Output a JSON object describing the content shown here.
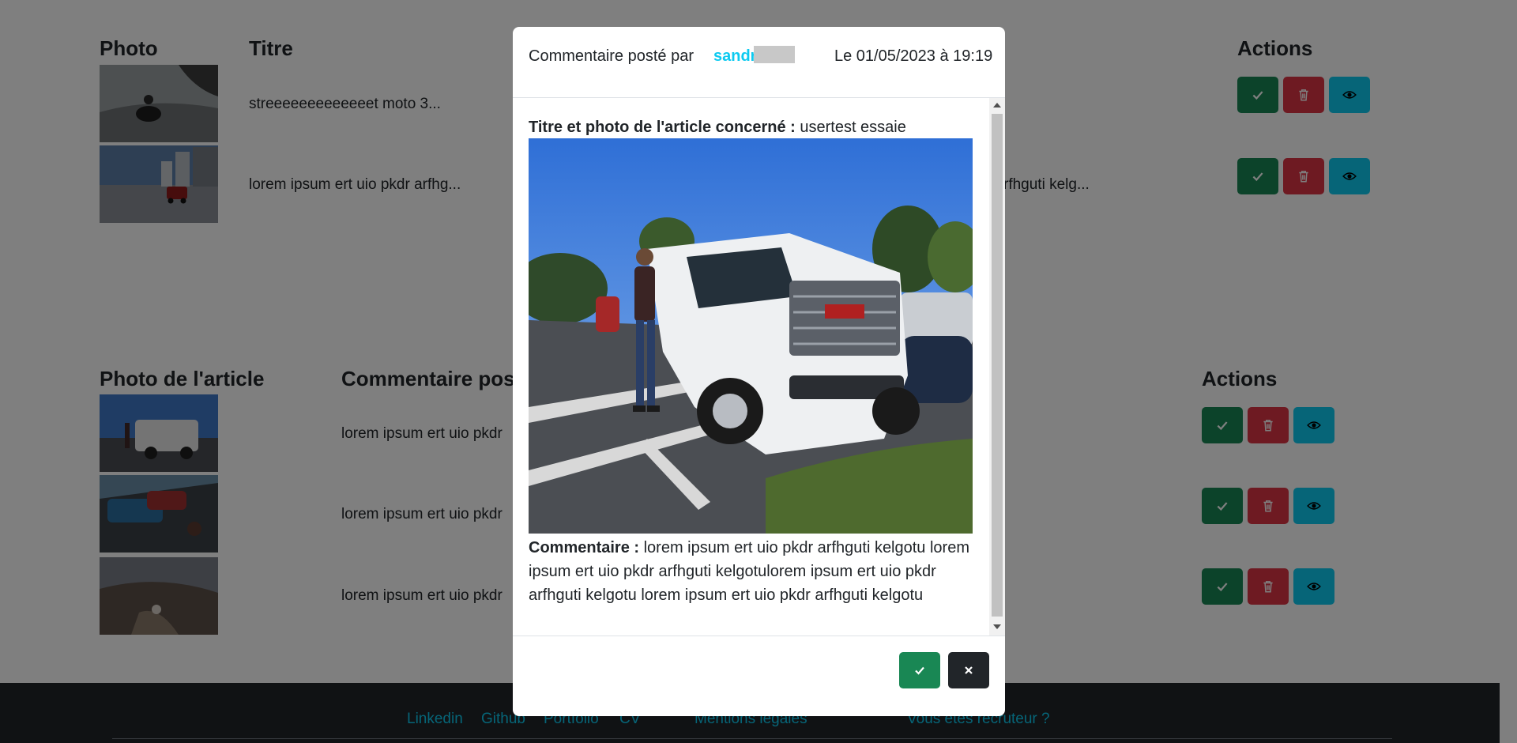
{
  "table1": {
    "headers": {
      "photo": "Photo",
      "title": "Titre",
      "actions": "Actions"
    },
    "rows": [
      {
        "title": "streeeeeeeeeeeeet moto 3...",
        "extra": ""
      },
      {
        "title": "lorem ipsum ert uio pkdr arfhg...",
        "extra": "rfhguti kelg..."
      }
    ]
  },
  "table2": {
    "headers": {
      "photo": "Photo de l'article",
      "comment": "Commentaire post",
      "actions": "Actions"
    },
    "rows": [
      {
        "comment": "lorem ipsum ert uio pkdr"
      },
      {
        "comment": "lorem ipsum ert uio pkdr"
      },
      {
        "comment": "lorem ipsum ert uio pkdr"
      }
    ]
  },
  "footer": {
    "links": [
      "Linkedin",
      "Github",
      "Portfolio",
      "CV",
      "Mentions légales",
      "Vous êtes recruteur ?"
    ]
  },
  "modal": {
    "posted_by_label": "Commentaire posté par",
    "username": "sandr",
    "date": "Le 01/05/2023 à 19:19",
    "article_label": "Titre et photo de l'article concerné :",
    "article_title": "usertest essaie",
    "comment_label": "Commentaire :",
    "comment_text": "lorem ipsum ert uio pkdr arfhguti kelgotu lorem ipsum ert uio pkdr arfhguti kelgotulorem ipsum ert uio pkdr arfhguti kelgotu lorem ipsum ert uio pkdr arfhguti kelgotu"
  },
  "colors": {
    "success": "#198754",
    "danger": "#dc3545",
    "info": "#0dcaf0",
    "dark": "#212529"
  },
  "icons": {
    "validate": "check-icon",
    "delete": "trash-icon",
    "view": "eye-icon",
    "close": "x-icon"
  }
}
